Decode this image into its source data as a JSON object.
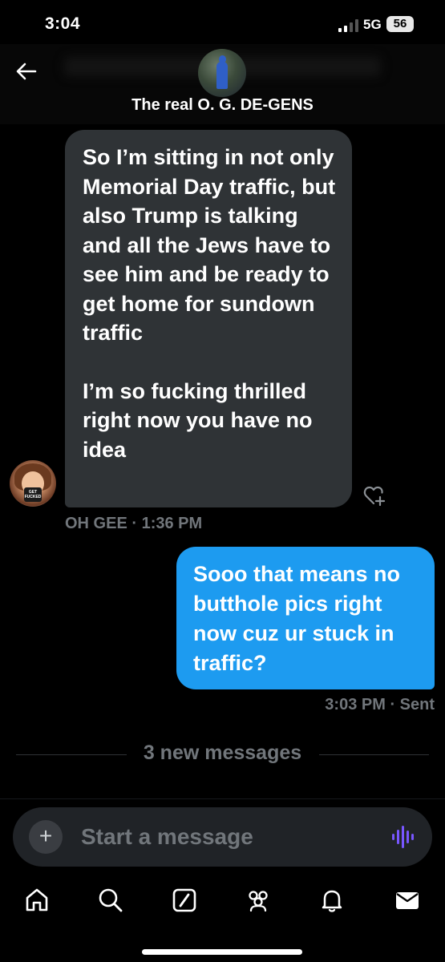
{
  "status_bar": {
    "time": "3:04",
    "network": "5G",
    "battery": "56"
  },
  "header": {
    "title": "The real O. G.  DE-GENS"
  },
  "messages": [
    {
      "direction": "incoming",
      "paragraphs": [
        "So I’m sitting in not only Memorial Day traffic, but also Trump is talking and all the Jews have to see him and be ready to get home for sundown traffic",
        "I’m so fucking thrilled right now you have no idea"
      ],
      "avatar_mug_text": "GET FUCKED",
      "meta": "OH GEE · 1:36 PM"
    },
    {
      "direction": "outgoing",
      "text": "Sooo that means no butthole pics right now cuz ur stuck in traffic?",
      "meta": "3:03 PM · Sent"
    }
  ],
  "new_messages_label": "3 new messages",
  "composer": {
    "placeholder": "Start a message",
    "plus_label": "+"
  },
  "bottom_nav": {
    "items": [
      {
        "name": "home",
        "icon": "home-icon"
      },
      {
        "name": "explore",
        "icon": "search-icon"
      },
      {
        "name": "grok",
        "icon": "grok-slash-icon"
      },
      {
        "name": "communities",
        "icon": "people-icon"
      },
      {
        "name": "notifications",
        "icon": "bell-icon"
      },
      {
        "name": "messages",
        "icon": "envelope-icon"
      }
    ]
  },
  "colors": {
    "background": "#000000",
    "incoming_bubble": "#2f3336",
    "outgoing_bubble": "#1d9bf0",
    "muted_text": "#71767b",
    "voice_accent": "#7856ff"
  }
}
